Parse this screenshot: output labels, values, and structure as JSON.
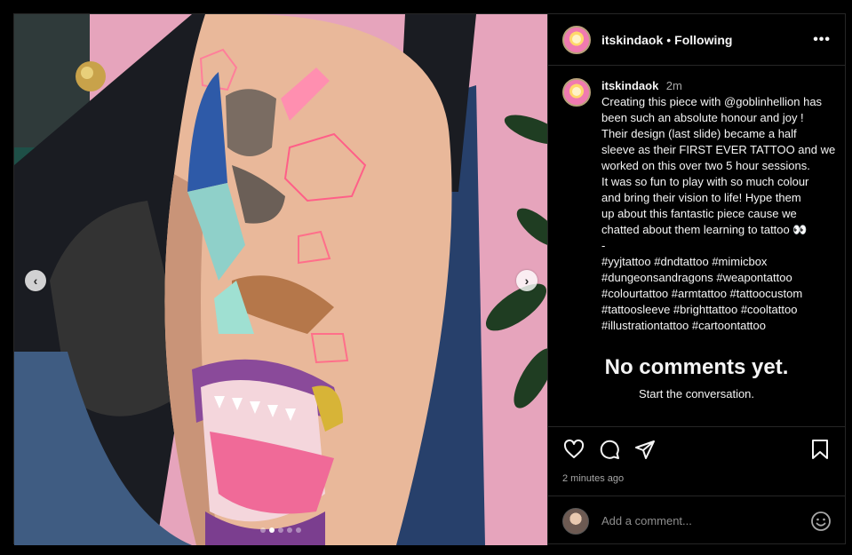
{
  "post": {
    "username": "itskindaok",
    "separator": "•",
    "follow_status": "Following",
    "more_icon": "more-horizontal-icon",
    "caption_time": "2m",
    "caption_lines": [
      "Creating this piece with @goblinhellion has",
      "been such an absolute honour and joy !",
      "Their design (last slide) became a half",
      "sleeve as their FIRST EVER TATTOO and we",
      "worked on this over two 5 hour sessions.",
      "It was so fun to play with so much colour",
      "and bring their vision to life! Hype them",
      "up about this fantastic piece cause we",
      "chatted about them learning to tattoo 👀",
      "-",
      "#yyjtattoo #dndtattoo #mimicbox",
      "#dungeonsandragons #weapontattoo",
      "#colourtattoo #armtattoo #tattoocustom",
      "#tattoosleeve #brighttattoo #cooltattoo",
      "#illustrationtattoo #cartoontattoo"
    ],
    "empty_title": "No comments yet.",
    "empty_sub": "Start the conversation.",
    "timestamp": "2 minutes ago",
    "comment_placeholder": "Add a comment...",
    "carousel": {
      "total_slides": 5,
      "active_slide": 1
    }
  },
  "icons": {
    "like": "heart-icon",
    "comment": "comment-icon",
    "share": "send-icon",
    "save": "bookmark-icon",
    "emoji": "emoji-icon",
    "prev": "chevron-left-icon",
    "next": "chevron-right-icon"
  },
  "colors": {
    "background": "#000000",
    "text": "#f5f5f5",
    "muted": "#a8a8a8",
    "border": "#262626",
    "wall": "#e8a0b8"
  }
}
